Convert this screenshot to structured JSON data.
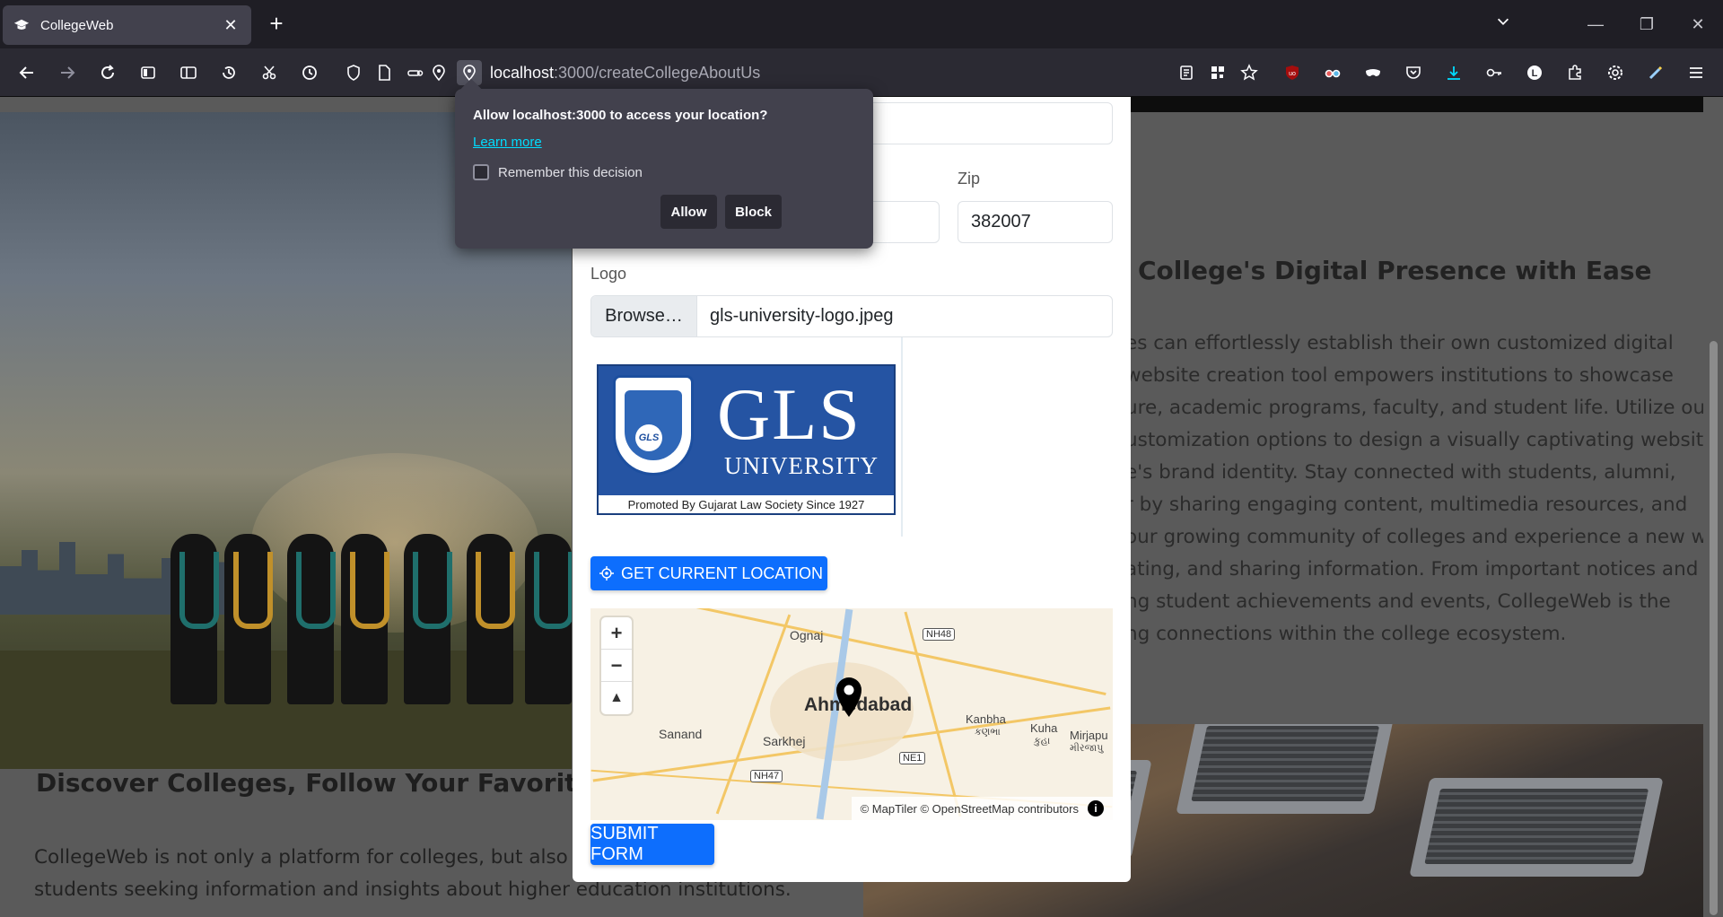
{
  "browser": {
    "tab_title": "CollegeWeb",
    "url_host": "localhost",
    "url_path": ":3000/createCollegeAboutUs"
  },
  "permission_popup": {
    "question": "Allow localhost:3000 to access your location?",
    "learn_more": "Learn more",
    "remember_label": "Remember this decision",
    "remember_checked": false,
    "allow_label": "Allow",
    "block_label": "Block"
  },
  "form": {
    "zip_label": "Zip",
    "zip_value": "382007",
    "logo_label": "Logo",
    "browse_label": "Browse…",
    "file_name": "gls-university-logo.jpeg",
    "logo_preview": {
      "name": "GLS",
      "sub": "UNIVERSITY",
      "promo": "Promoted By Gujarat Law Society Since 1927",
      "badge": "GLS"
    },
    "location_button": "GET CURRENT LOCATION",
    "submit_button": "SUBMIT FORM"
  },
  "map": {
    "labels": {
      "city": "Ahmedabad",
      "ognaj": "Ognaj",
      "sanand": "Sanand",
      "sarkhej": "Sarkhej",
      "kanbha": "Kanbha",
      "kanbha_local": "કણભા",
      "kuha": "Kuha",
      "kuha_local": "કુહા",
      "mirjapur": "Mirjapu",
      "mirjapur_local": "મીરજાપુ"
    },
    "shields": {
      "nh48": "NH48",
      "nh47": "NH47",
      "ne1": "NE1"
    },
    "zoom_in": "+",
    "zoom_out": "−",
    "compass": "▲",
    "attribution": "© MapTiler © OpenStreetMap contributors",
    "info": "i"
  },
  "about": {
    "title": "College's Digital Presence with Ease",
    "lines": [
      "es can effortlessly establish their own customized digital",
      "website creation tool empowers institutions to showcase",
      "ure, academic programs, faculty, and student life. Utilize our",
      "ustomization options to design a visually captivating website",
      "e's brand identity. Stay connected with students, alumni,",
      "r by sharing engaging content, multimedia resources, and",
      "our growing community of colleges and experience a new way",
      "ating, and sharing information. From important notices and",
      "ng student achievements and events, CollegeWeb is the",
      "ng connections within the college ecosystem."
    ]
  },
  "discover": {
    "title": "Discover Colleges, Follow Your Favorites, a",
    "lines": [
      "CollegeWeb is not only a platform for colleges, but also a",
      "students seeking information and insights about higher education institutions."
    ]
  }
}
